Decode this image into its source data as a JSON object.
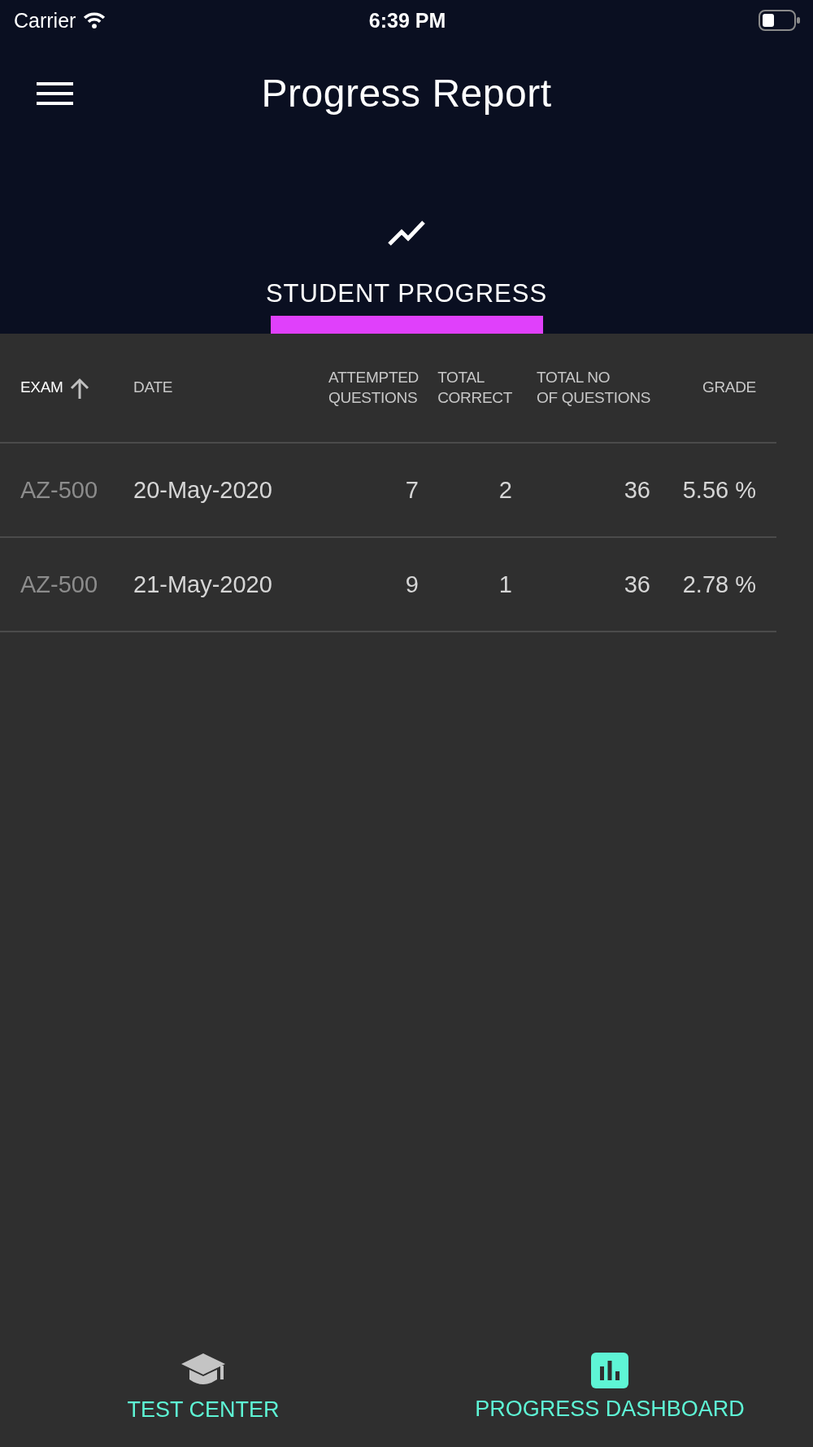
{
  "status_bar": {
    "carrier": "Carrier",
    "time": "6:39 PM"
  },
  "header": {
    "title": "Progress Report"
  },
  "tabs": [
    {
      "label": "STUDENT PROGRESS",
      "selected": true
    }
  ],
  "table": {
    "columns": [
      {
        "label": "EXAM",
        "sorted": true
      },
      {
        "label": "DATE",
        "sorted": false
      },
      {
        "label": "ATTEMPTED\nQUESTIONS",
        "sorted": false
      },
      {
        "label": "TOTAL\nCORRECT",
        "sorted": false
      },
      {
        "label": "TOTAL NO\nOF QUESTIONS",
        "sorted": false
      },
      {
        "label": "GRADE",
        "sorted": false
      }
    ],
    "rows": [
      {
        "cells": [
          "AZ-500",
          "20-May-2020",
          "7",
          "2",
          "36",
          "5.56 %"
        ]
      },
      {
        "cells": [
          "AZ-500",
          "21-May-2020",
          "9",
          "1",
          "36",
          "2.78 %"
        ]
      }
    ]
  },
  "bottom_nav": [
    {
      "label": "TEST CENTER",
      "selected": false
    },
    {
      "label": "PROGRESS DASHBOARD",
      "selected": true
    }
  ]
}
